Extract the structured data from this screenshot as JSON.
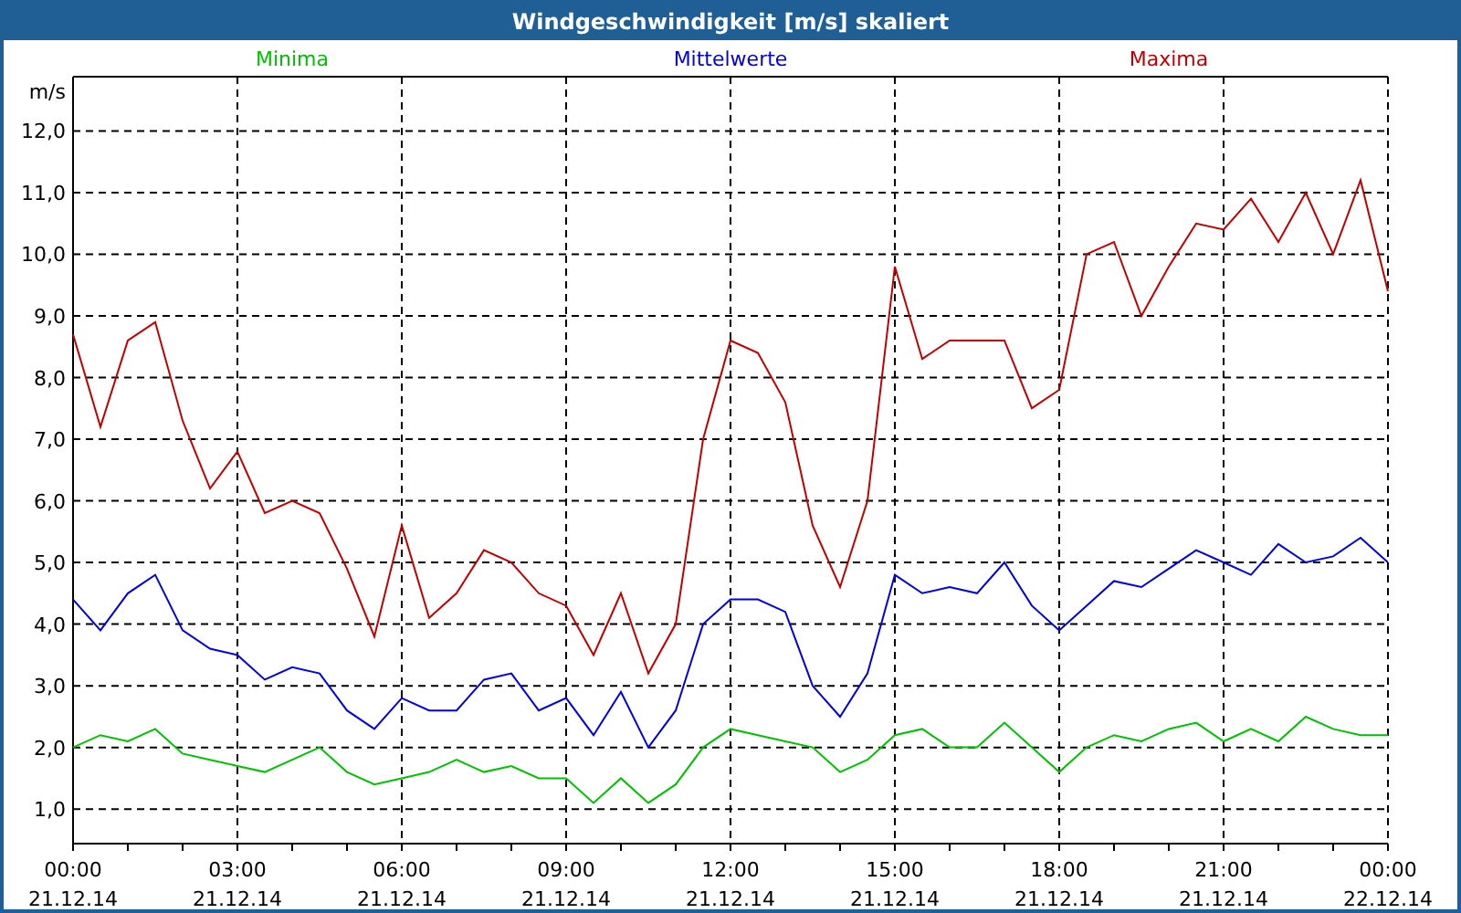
{
  "window": {
    "title": "Windgeschwindigkeit [m/s] skaliert"
  },
  "chart": {
    "chart_data": {
      "type": "line",
      "grid": true,
      "ylabel": "m/s",
      "ylim": [
        0.44,
        12.88
      ],
      "categories": [
        "00:00\n21.12.14",
        null,
        null,
        null,
        null,
        null,
        "03:00\n21.12.14",
        null,
        null,
        null,
        null,
        null,
        "06:00\n21.12.14",
        null,
        null,
        null,
        null,
        null,
        "09:00\n21.12.14",
        null,
        null,
        null,
        null,
        null,
        "12:00\n21.12.14",
        null,
        null,
        null,
        null,
        null,
        "15:00\n21.12.14",
        null,
        null,
        null,
        null,
        null,
        "18:00\n21.12.14",
        null,
        null,
        null,
        null,
        null,
        "21:00\n21.12.14",
        null,
        null,
        null,
        null,
        null,
        "00:00\n22.12.14"
      ],
      "series": [
        {
          "name": "Minima",
          "color": "#00c000",
          "values": [
            2.0,
            2.2,
            2.1,
            2.3,
            1.9,
            1.8,
            1.7,
            1.6,
            1.8,
            2.0,
            1.6,
            1.4,
            1.5,
            1.6,
            1.8,
            1.6,
            1.7,
            1.5,
            1.5,
            1.1,
            1.5,
            1.1,
            1.4,
            2.0,
            2.3,
            2.2,
            2.1,
            2.0,
            1.6,
            1.8,
            2.2,
            2.3,
            2.0,
            2.0,
            2.4,
            2.0,
            1.6,
            2.0,
            2.2,
            2.1,
            2.3,
            2.4,
            2.1,
            2.3,
            2.1,
            2.5,
            2.3,
            2.2,
            2.2
          ]
        },
        {
          "name": "Mittelwerte",
          "color": "#0000e0",
          "values": [
            4.4,
            3.9,
            4.5,
            4.8,
            3.9,
            3.6,
            3.5,
            3.1,
            3.3,
            3.2,
            2.6,
            2.3,
            2.8,
            2.6,
            2.6,
            3.1,
            3.2,
            2.6,
            2.8,
            2.2,
            2.9,
            2.0,
            2.6,
            4.0,
            4.4,
            4.4,
            4.2,
            3.0,
            2.5,
            3.2,
            4.8,
            4.5,
            4.6,
            4.5,
            5.0,
            4.3,
            3.9,
            4.3,
            4.7,
            4.6,
            4.9,
            5.2,
            5.0,
            4.8,
            5.3,
            5.0,
            5.1,
            5.4,
            5.0
          ]
        },
        {
          "name": "Maxima",
          "color": "#c00000",
          "values": [
            8.7,
            7.2,
            8.6,
            8.9,
            7.3,
            6.2,
            6.8,
            5.8,
            6.0,
            5.8,
            4.9,
            3.8,
            5.6,
            4.1,
            4.5,
            5.2,
            5.0,
            4.5,
            4.3,
            3.5,
            4.5,
            3.2,
            4.0,
            7.0,
            8.6,
            8.4,
            7.6,
            5.6,
            4.6,
            6.0,
            9.8,
            8.3,
            8.6,
            8.6,
            8.6,
            7.5,
            7.8,
            10.0,
            10.2,
            9.0,
            9.8,
            10.5,
            10.4,
            10.9,
            10.2,
            11.0,
            10.0,
            11.2,
            9.4
          ]
        }
      ],
      "yticks": [
        {
          "value": 1,
          "label": "1,0"
        },
        {
          "value": 2,
          "label": "2,0"
        },
        {
          "value": 3,
          "label": "3,0"
        },
        {
          "value": 4,
          "label": "4,0"
        },
        {
          "value": 5,
          "label": "5,0"
        },
        {
          "value": 6,
          "label": "6,0"
        },
        {
          "value": 7,
          "label": "7,0"
        },
        {
          "value": 8,
          "label": "8,0"
        },
        {
          "value": 9,
          "label": "9,0"
        },
        {
          "value": 10,
          "label": "10,0"
        },
        {
          "value": 11,
          "label": "11,0"
        },
        {
          "value": 12,
          "label": "12,0"
        }
      ]
    }
  }
}
